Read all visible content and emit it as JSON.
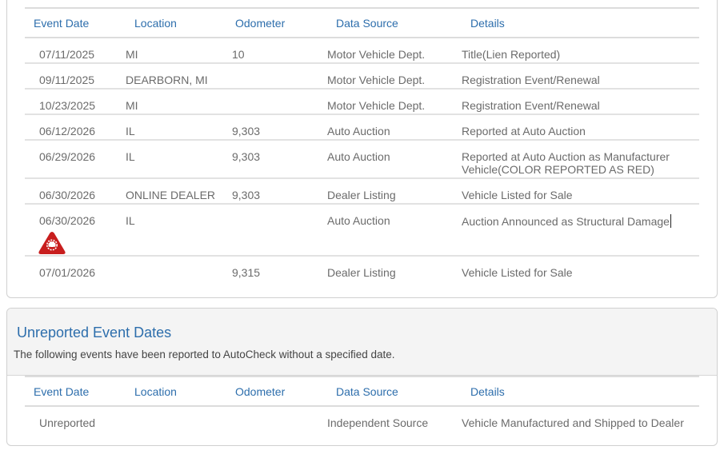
{
  "columns": [
    "Event Date",
    "Location",
    "Odometer",
    "Data Source",
    "Details"
  ],
  "events": [
    {
      "date": "07/11/2025",
      "location": "MI",
      "odometer": "10",
      "source": "Motor Vehicle Dept.",
      "details": "Title(Lien Reported)"
    },
    {
      "date": "09/11/2025",
      "location": "DEARBORN, MI",
      "odometer": "",
      "source": "Motor Vehicle Dept.",
      "details": "Registration Event/Renewal"
    },
    {
      "date": "10/23/2025",
      "location": "MI",
      "odometer": "",
      "source": "Motor Vehicle Dept.",
      "details": "Registration Event/Renewal"
    },
    {
      "date": "06/12/2026",
      "location": "IL",
      "odometer": "9,303",
      "source": "Auto Auction",
      "details": "Reported at Auto Auction"
    },
    {
      "date": "06/29/2026",
      "location": "IL",
      "odometer": "9,303",
      "source": "Auto Auction",
      "details": "Reported at Auto Auction as Manufacturer Vehicle(COLOR REPORTED AS RED)"
    },
    {
      "date": "06/30/2026",
      "location": "ONLINE DEALER",
      "odometer": "9,303",
      "source": "Dealer Listing",
      "details": "Vehicle Listed for Sale"
    },
    {
      "date": "06/30/2026",
      "location": "IL",
      "odometer": "",
      "source": "Auto Auction",
      "details": "Auction Announced as Structural Damage",
      "icon": "vehicle-damage-warning-icon",
      "icon_color": "#c81e1e"
    },
    {
      "date": "07/01/2026",
      "location": "",
      "odometer": "9,315",
      "source": "Dealer Listing",
      "details": "Vehicle Listed for Sale"
    }
  ],
  "unreported": {
    "title": "Unreported Event Dates",
    "subtitle": "The following events have been reported to AutoCheck without a specified date.",
    "events": [
      {
        "date": "Unreported",
        "location": "",
        "odometer": "",
        "source": "Independent Source",
        "details": "Vehicle Manufactured and Shipped to Dealer"
      }
    ]
  },
  "colors": {
    "accent": "#2d6eac",
    "text": "#6b6b6b",
    "warning": "#c81e1e"
  }
}
